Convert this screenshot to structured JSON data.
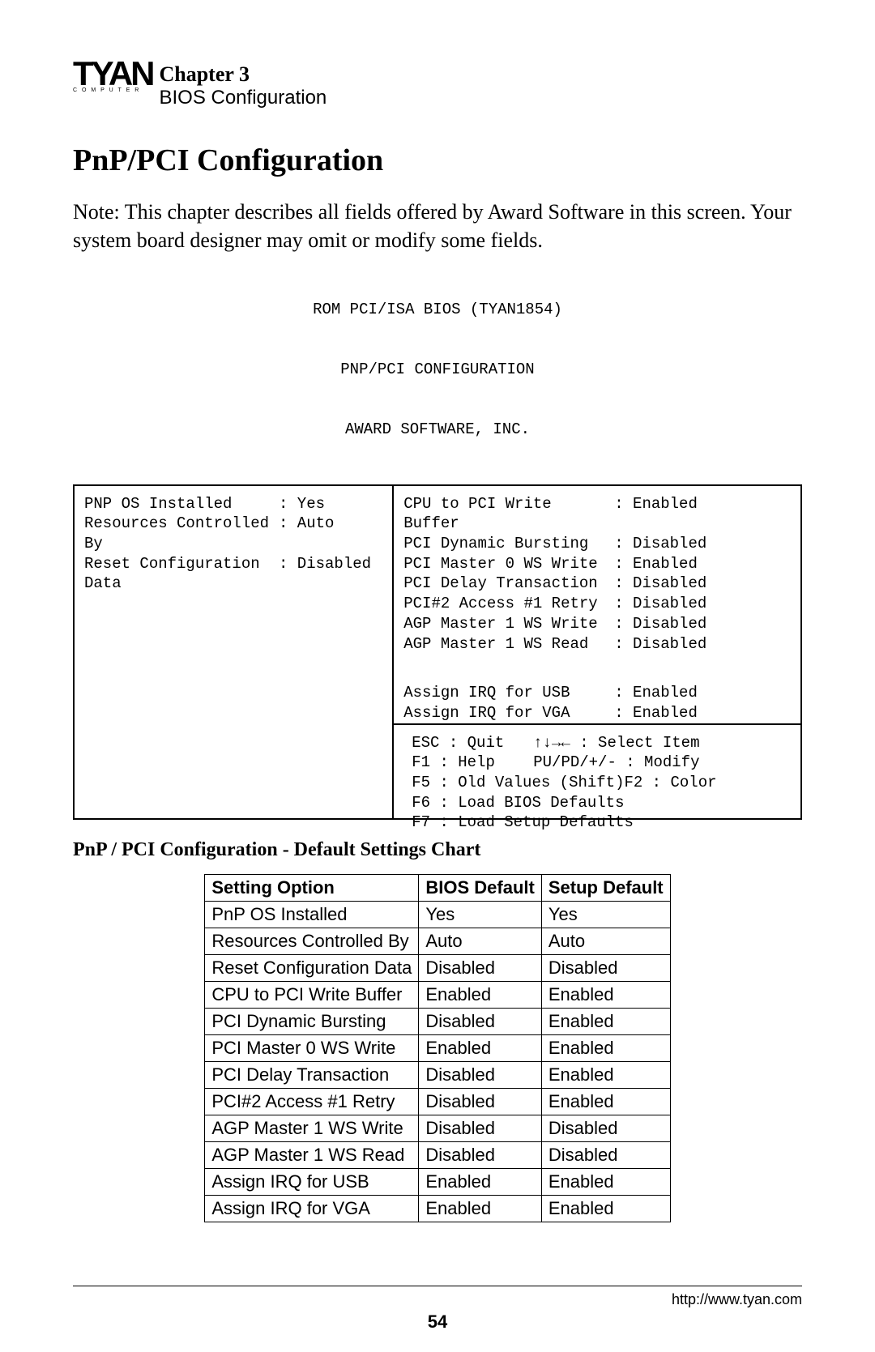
{
  "header": {
    "brand": "TYAN",
    "brand_sub": "C O M P U T E R",
    "chapter": "Chapter 3",
    "subtitle": "BIOS  Configuration"
  },
  "section_title": "PnP/PCI Configuration",
  "note": "Note: This chapter describes all fields offered by Award Software in this screen. Your system board designer may omit or modify some fields.",
  "bios_header": {
    "line1": "ROM PCI/ISA BIOS (TYAN1854)",
    "line2": "PNP/PCI CONFIGURATION",
    "line3": "AWARD SOFTWARE, INC."
  },
  "bios_left": [
    {
      "label": "PNP OS Installed",
      "value": ": Yes"
    },
    {
      "label": "Resources Controlled By",
      "value": ": Auto"
    },
    {
      "label": "Reset Configuration Data",
      "value": ": Disabled"
    }
  ],
  "bios_right_top": [
    {
      "label": "CPU to PCI Write Buffer",
      "value": ": Enabled"
    },
    {
      "label": "PCI Dynamic Bursting",
      "value": ": Disabled"
    },
    {
      "label": "PCI Master 0 WS Write",
      "value": ": Enabled"
    },
    {
      "label": "PCI Delay Transaction",
      "value": ": Disabled"
    },
    {
      "label": "PCI#2 Access #1 Retry",
      "value": ": Disabled"
    },
    {
      "label": "AGP Master 1 WS Write",
      "value": ": Disabled"
    },
    {
      "label": "AGP Master 1 WS Read",
      "value": ": Disabled"
    }
  ],
  "bios_right_mid": [
    {
      "label": "Assign IRQ for USB",
      "value": ": Enabled"
    },
    {
      "label": "Assign IRQ for VGA",
      "value": ": Enabled"
    }
  ],
  "bios_help": {
    "l1a": "ESC : Quit",
    "l1b": "↑↓→← : Select Item",
    "l2a": "F1 : Help",
    "l2b": "PU/PD/+/- : Modify",
    "l3": "F5 : Old Values  (Shift)F2 : Color",
    "l4": "F6 : Load BIOS  Defaults",
    "l5": "F7 : Load Setup Defaults"
  },
  "sub_heading": "PnP / PCI Configuration - Default Settings Chart",
  "chart_data": {
    "type": "table",
    "headers": [
      "Setting Option",
      "BIOS Default",
      "Setup Default"
    ],
    "rows": [
      [
        "PnP OS Installed",
        "Yes",
        "Yes"
      ],
      [
        "Resources Controlled By",
        "Auto",
        "Auto"
      ],
      [
        "Reset Configuration Data",
        "Disabled",
        "Disabled"
      ],
      [
        "CPU to PCI Write Buffer",
        "Enabled",
        "Enabled"
      ],
      [
        "PCI Dynamic Bursting",
        "Disabled",
        "Enabled"
      ],
      [
        "PCI Master 0 WS Write",
        "Enabled",
        "Enabled"
      ],
      [
        "PCI Delay Transaction",
        "Disabled",
        "Enabled"
      ],
      [
        "PCI#2 Access #1 Retry",
        "Disabled",
        "Enabled"
      ],
      [
        "AGP Master 1 WS Write",
        "Disabled",
        "Disabled"
      ],
      [
        "AGP Master 1 WS Read",
        "Disabled",
        "Disabled"
      ],
      [
        "Assign IRQ for USB",
        "Enabled",
        "Enabled"
      ],
      [
        "Assign IRQ for VGA",
        "Enabled",
        "Enabled"
      ]
    ]
  },
  "footer": {
    "url": "http://www.tyan.com",
    "page": "54"
  }
}
